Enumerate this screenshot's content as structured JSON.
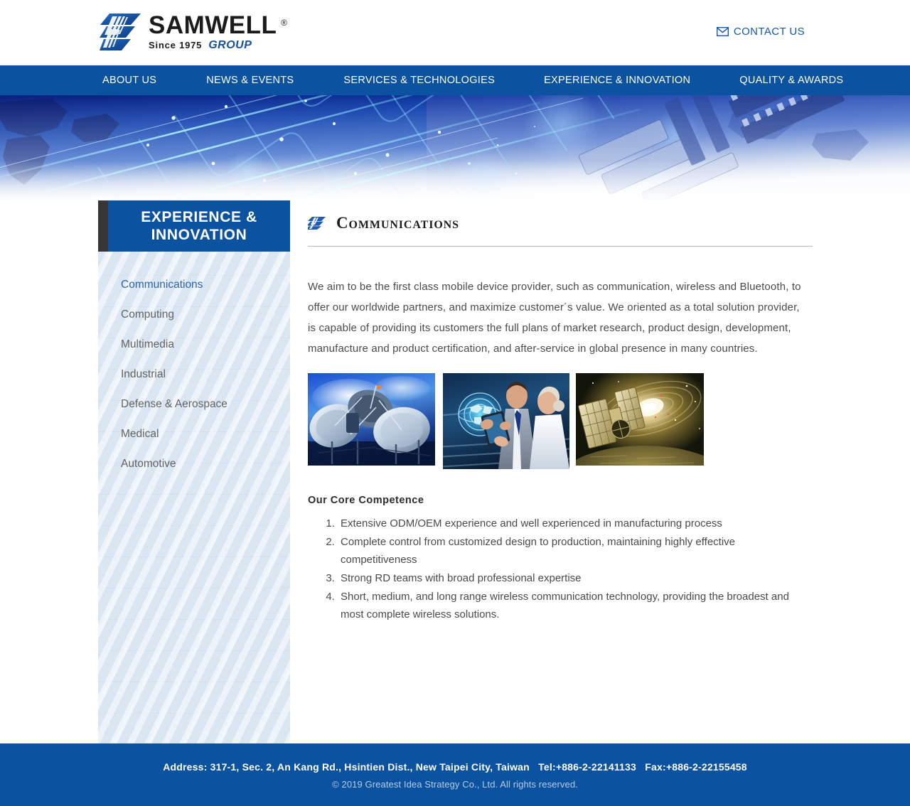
{
  "header": {
    "logo": {
      "word": "SAMWELL",
      "registered": "®",
      "since": "Since 1975",
      "group": "GROUP",
      "mark_icon": "samwell-z-logo-icon"
    },
    "contact": {
      "label": "CONTACT US",
      "icon": "envelope-icon"
    }
  },
  "nav": {
    "items": [
      {
        "label": "ABOUT US"
      },
      {
        "label": "NEWS & EVENTS"
      },
      {
        "label": "SERVICES & TECHNOLOGIES"
      },
      {
        "label": "EXPERIENCE & INNOVATION"
      },
      {
        "label": "QUALITY & AWARDS"
      }
    ]
  },
  "hero": {
    "alt": "blue circuit board and network technology banner"
  },
  "sidebar": {
    "title": "EXPERIENCE &\nINNOVATION",
    "items": [
      {
        "label": "Communications",
        "active": true
      },
      {
        "label": "Computing",
        "active": false
      },
      {
        "label": "Multimedia",
        "active": false
      },
      {
        "label": "Industrial",
        "active": false
      },
      {
        "label": "Defense & Aerospace",
        "active": false
      },
      {
        "label": "Medical",
        "active": false
      },
      {
        "label": "Automotive",
        "active": false
      }
    ]
  },
  "main": {
    "heading": "Communications",
    "heading_icon": "samwell-z-logo-icon",
    "intro": "We aim to be the first class mobile device provider, such as communication, wireless and Bluetooth, to offer our worldwide partners, and maximize customer´s value. We oriented as a total solution provider, is capable of providing its customers the full plans of market research, product design, development, manufacture and product certification, and after-service in global presence in many countries.",
    "images": [
      {
        "alt": "satellite dish array against blue sky"
      },
      {
        "alt": "businessman and businesswoman viewing holographic tablet interface"
      },
      {
        "alt": "golden satellite orbiting a planet in space"
      }
    ],
    "core_title": "Our Core Competence",
    "core_items": [
      "Extensive ODM/OEM experience and well experienced in manufacturing process",
      "Complete control from customized design to production, maintaining highly effective competitiveness",
      "Strong RD teams with broad professional expertise",
      "Short, medium, and long range wireless communication technology, providing the broadest and most complete wireless solutions."
    ]
  },
  "footer": {
    "address": "Address: 317-1, Sec. 2, An Kang Rd., Hsintien Dist., New Taipei City, Taiwan   Tel:+886-2-22141133   Fax:+886-2-22155458",
    "copyright": "© 2019 Greatest Idea Strategy Co., Ltd. All rights reserved."
  },
  "colors": {
    "brand_blue": "#0b52a0",
    "logo_blue": "#1351a0",
    "dark_bar": "#373737",
    "sidebar_bg": "#dbe6f3",
    "active_link": "#2a63b3",
    "body_text": "#4a4a4a"
  }
}
